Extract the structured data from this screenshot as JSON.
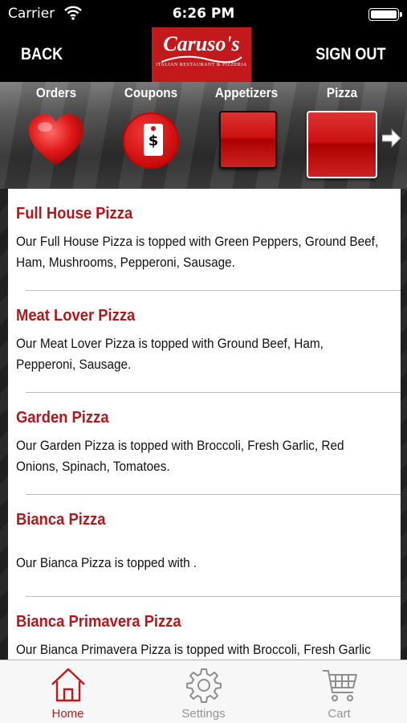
{
  "status_bar": {
    "carrier": "Carrier",
    "time": "6:26 PM"
  },
  "header": {
    "back_label": "BACK",
    "signout_label": "SIGN OUT",
    "logo_text": "Caruso's",
    "logo_subtext": "ITALIAN RESTAURANT & PIZZERIA",
    "logo_color": "#c3191c"
  },
  "categories": [
    {
      "label": "Orders",
      "icon": "heart-icon"
    },
    {
      "label": "Coupons",
      "icon": "price-tag-icon"
    },
    {
      "label": "Appetizers",
      "icon": "red-square-thumbnail"
    },
    {
      "label": "Pizza",
      "icon": "red-square-thumbnail"
    }
  ],
  "menu_items": [
    {
      "title": "Full House Pizza",
      "description": "Our Full House Pizza is topped with Green Peppers, Ground Beef, Ham, Mushrooms, Pepperoni, Sausage."
    },
    {
      "title": "Meat Lover Pizza",
      "description": "Our Meat Lover Pizza is topped with Ground Beef, Ham, Pepperoni, Sausage."
    },
    {
      "title": "Garden Pizza",
      "description": "Our Garden Pizza is topped with Broccoli, Fresh Garlic, Red Onions, Spinach, Tomatoes."
    },
    {
      "title": "Bianca Pizza",
      "description": "Our Bianca Pizza is topped with ."
    },
    {
      "title": "Bianca Primavera Pizza",
      "description": "Our Bianca Primavera Pizza is topped with Broccoli, Fresh Garlic"
    }
  ],
  "tabs": [
    {
      "label": "Home",
      "icon": "home-icon",
      "active": true
    },
    {
      "label": "Settings",
      "icon": "gear-icon",
      "active": false
    },
    {
      "label": "Cart",
      "icon": "cart-icon",
      "active": false
    }
  ],
  "colors": {
    "accent_red": "#c3191c",
    "title_red": "#b3161b",
    "inactive_tab": "#929292"
  }
}
